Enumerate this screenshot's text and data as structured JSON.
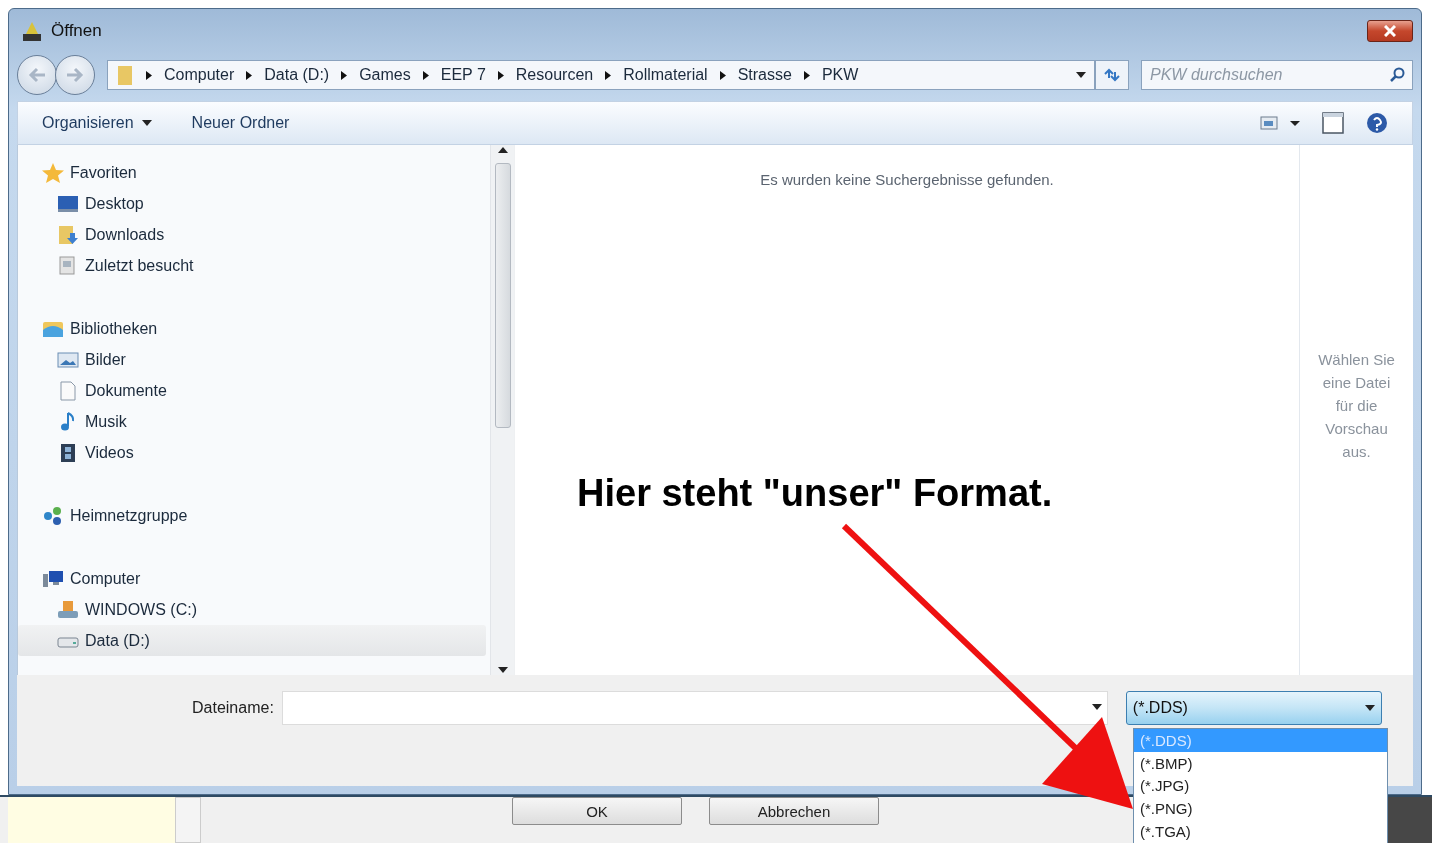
{
  "window": {
    "title": "Öffnen"
  },
  "address": {
    "path": [
      "Computer",
      "Data (D:)",
      "Games",
      "EEP 7",
      "Resourcen",
      "Rollmaterial",
      "Strasse",
      "PKW"
    ]
  },
  "search": {
    "placeholder": "PKW durchsuchen"
  },
  "toolbar": {
    "items": [
      {
        "label": "Organisieren",
        "kind": "menu"
      },
      {
        "label": "Neuer Ordner",
        "kind": "button"
      }
    ]
  },
  "navigation": {
    "groups": [
      {
        "label": "Favoriten",
        "selected": false,
        "children": [
          {
            "label": "Desktop",
            "selected": false
          },
          {
            "label": "Downloads",
            "selected": false
          },
          {
            "label": "Zuletzt besucht",
            "selected": false
          }
        ]
      },
      {
        "label": "Bibliotheken",
        "selected": false,
        "children": [
          {
            "label": "Bilder",
            "selected": false
          },
          {
            "label": "Dokumente",
            "selected": false
          },
          {
            "label": "Musik",
            "selected": false
          },
          {
            "label": "Videos",
            "selected": false
          }
        ]
      },
      {
        "label": "Heimnetzgruppe",
        "selected": false
      },
      {
        "label": "Computer",
        "selected": false,
        "children": [
          {
            "label": "WINDOWS (C:)",
            "selected": false
          },
          {
            "label": "Data (D:)",
            "selected": true
          }
        ]
      }
    ]
  },
  "content": {
    "message": "Es wurden keine Suchergebnisse gefunden."
  },
  "preview": {
    "message": "Wählen Sie eine Datei für die Vorschau aus."
  },
  "filename": {
    "label": "Dateiname:"
  },
  "filetype": {
    "value": "(*.DDS)",
    "expanded": true,
    "options": [
      {
        "label": "(*.DDS)",
        "selected": true
      },
      {
        "label": "(*.BMP)",
        "selected": false
      },
      {
        "label": "(*.JPG)",
        "selected": false
      },
      {
        "label": "(*.PNG)",
        "selected": false
      },
      {
        "label": "(*.TGA)",
        "selected": false
      }
    ]
  },
  "background_window": {
    "buttons": [
      "OK",
      "Abbrechen"
    ]
  },
  "annotation": {
    "text": "Hier steht \"unser\" Format."
  }
}
